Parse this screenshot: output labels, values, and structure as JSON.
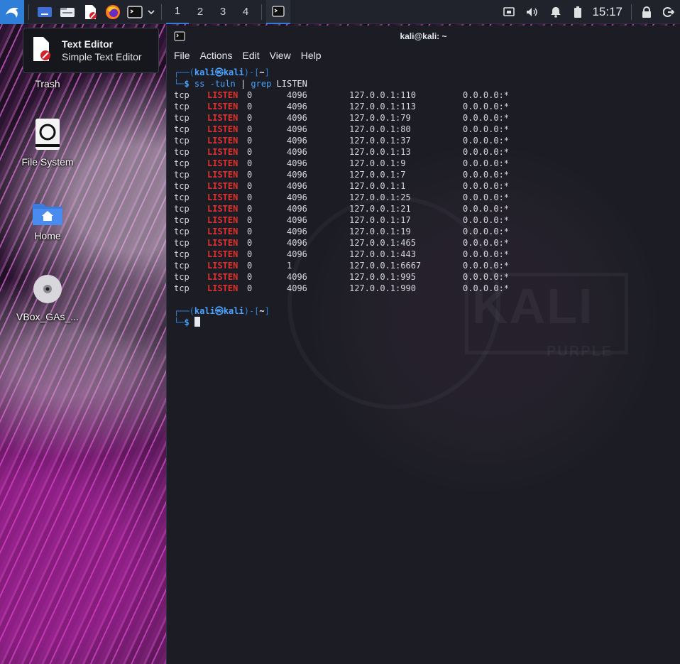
{
  "panel": {
    "workspaces": [
      "1",
      "2",
      "3",
      "4"
    ],
    "active_workspace": "1",
    "clock": "15:17",
    "accent": "#2f7fd9",
    "launchers": [
      "kali-menu-icon",
      "show-desktop-icon",
      "file-manager-icon",
      "text-editor-icon",
      "firefox-icon",
      "terminal-icon"
    ],
    "tray": [
      "network-icon",
      "volume-icon",
      "notification-icon",
      "battery-icon"
    ]
  },
  "tooltip": {
    "title": "Text Editor",
    "subtitle": "Simple Text Editor"
  },
  "desktop": {
    "icons": [
      {
        "label": "Trash"
      },
      {
        "label": "File System"
      },
      {
        "label": "Home"
      },
      {
        "label": "VBox_GAs_..."
      }
    ]
  },
  "terminal": {
    "title": "kali@kali: ~",
    "menu": [
      "File",
      "Actions",
      "Edit",
      "View",
      "Help"
    ],
    "prompt": {
      "frame_top_left": "┌──(",
      "user": "kali",
      "at": "㉿",
      "host": "kali",
      "mid": ")-[",
      "dir": "~",
      "end": "]",
      "frame_bottom_left": "└─",
      "dollar": "$"
    },
    "command": {
      "cmd": "ss",
      "args": " -tuln ",
      "pipe": "|",
      "grep": " grep",
      "pattern": " LISTEN"
    },
    "rows": [
      {
        "proto": "tcp",
        "state": "LISTEN",
        "recv": "0",
        "send": "4096",
        "local": "127.0.0.1:110",
        "peer": "0.0.0.0:*"
      },
      {
        "proto": "tcp",
        "state": "LISTEN",
        "recv": "0",
        "send": "4096",
        "local": "127.0.0.1:113",
        "peer": "0.0.0.0:*"
      },
      {
        "proto": "tcp",
        "state": "LISTEN",
        "recv": "0",
        "send": "4096",
        "local": "127.0.0.1:79",
        "peer": "0.0.0.0:*"
      },
      {
        "proto": "tcp",
        "state": "LISTEN",
        "recv": "0",
        "send": "4096",
        "local": "127.0.0.1:80",
        "peer": "0.0.0.0:*"
      },
      {
        "proto": "tcp",
        "state": "LISTEN",
        "recv": "0",
        "send": "4096",
        "local": "127.0.0.1:37",
        "peer": "0.0.0.0:*"
      },
      {
        "proto": "tcp",
        "state": "LISTEN",
        "recv": "0",
        "send": "4096",
        "local": "127.0.0.1:13",
        "peer": "0.0.0.0:*"
      },
      {
        "proto": "tcp",
        "state": "LISTEN",
        "recv": "0",
        "send": "4096",
        "local": "127.0.0.1:9",
        "peer": "0.0.0.0:*"
      },
      {
        "proto": "tcp",
        "state": "LISTEN",
        "recv": "0",
        "send": "4096",
        "local": "127.0.0.1:7",
        "peer": "0.0.0.0:*"
      },
      {
        "proto": "tcp",
        "state": "LISTEN",
        "recv": "0",
        "send": "4096",
        "local": "127.0.0.1:1",
        "peer": "0.0.0.0:*"
      },
      {
        "proto": "tcp",
        "state": "LISTEN",
        "recv": "0",
        "send": "4096",
        "local": "127.0.0.1:25",
        "peer": "0.0.0.0:*"
      },
      {
        "proto": "tcp",
        "state": "LISTEN",
        "recv": "0",
        "send": "4096",
        "local": "127.0.0.1:21",
        "peer": "0.0.0.0:*"
      },
      {
        "proto": "tcp",
        "state": "LISTEN",
        "recv": "0",
        "send": "4096",
        "local": "127.0.0.1:17",
        "peer": "0.0.0.0:*"
      },
      {
        "proto": "tcp",
        "state": "LISTEN",
        "recv": "0",
        "send": "4096",
        "local": "127.0.0.1:19",
        "peer": "0.0.0.0:*"
      },
      {
        "proto": "tcp",
        "state": "LISTEN",
        "recv": "0",
        "send": "4096",
        "local": "127.0.0.1:465",
        "peer": "0.0.0.0:*"
      },
      {
        "proto": "tcp",
        "state": "LISTEN",
        "recv": "0",
        "send": "4096",
        "local": "127.0.0.1:443",
        "peer": "0.0.0.0:*"
      },
      {
        "proto": "tcp",
        "state": "LISTEN",
        "recv": "0",
        "send": "1",
        "local": "127.0.0.1:6667",
        "peer": "0.0.0.0:*"
      },
      {
        "proto": "tcp",
        "state": "LISTEN",
        "recv": "0",
        "send": "4096",
        "local": "127.0.0.1:995",
        "peer": "0.0.0.0:*"
      },
      {
        "proto": "tcp",
        "state": "LISTEN",
        "recv": "0",
        "send": "4096",
        "local": "127.0.0.1:990",
        "peer": "0.0.0.0:*"
      }
    ],
    "watermark": {
      "brand": "KALI",
      "edition": "PURPLE"
    }
  }
}
